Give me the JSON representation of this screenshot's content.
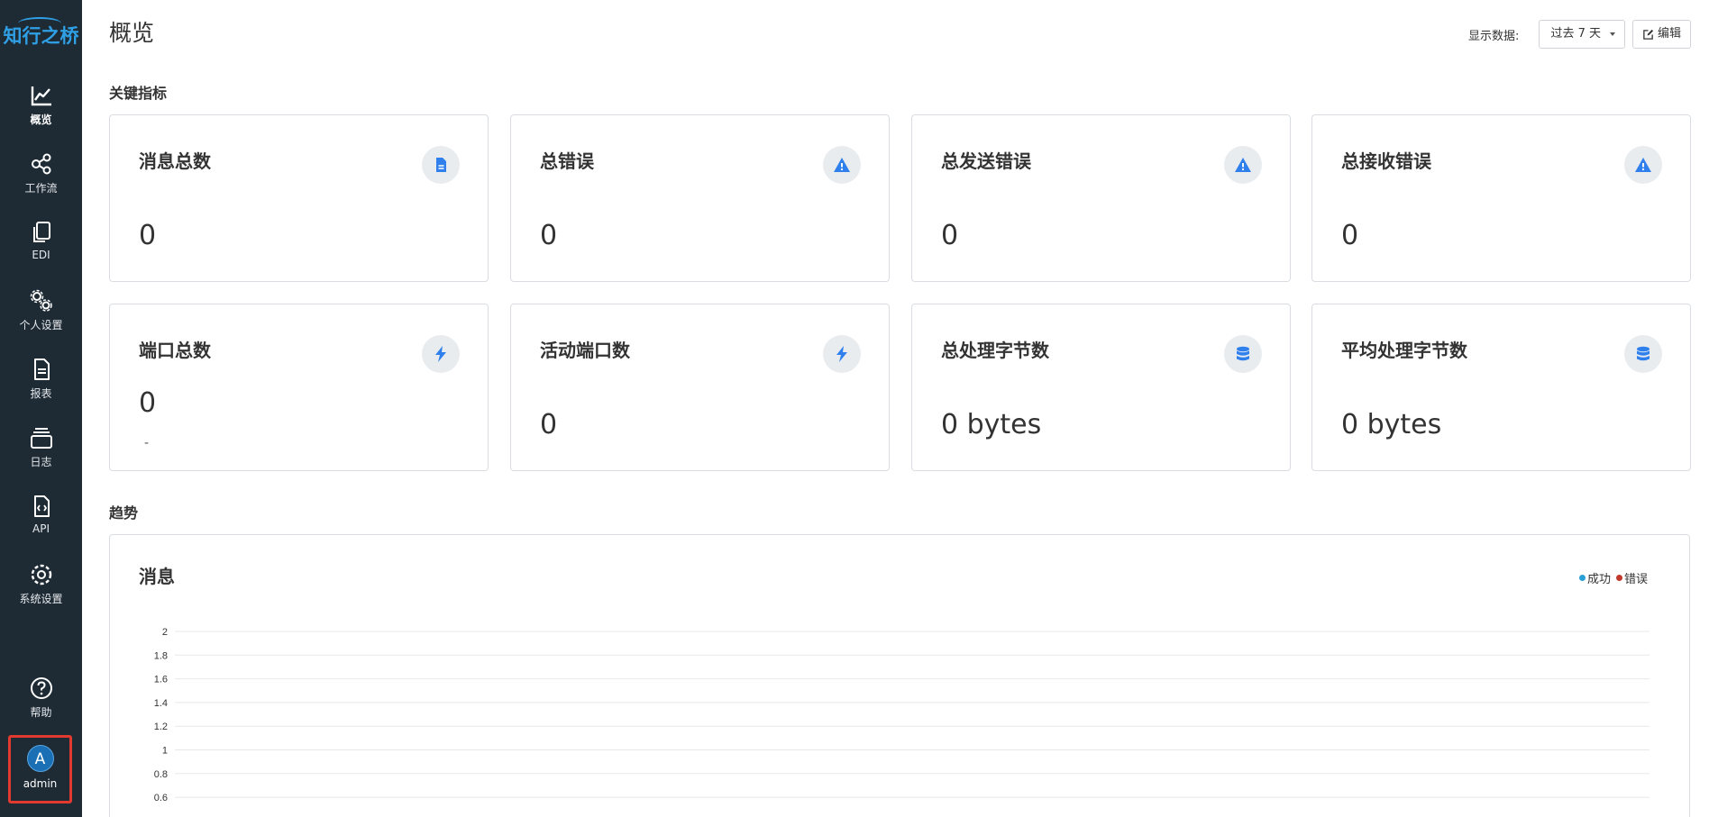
{
  "sidebar": {
    "logo": "知行之桥",
    "items": [
      {
        "label": "概览",
        "icon": "chart-line-icon"
      },
      {
        "label": "工作流",
        "icon": "share-nodes-icon"
      },
      {
        "label": "EDI",
        "icon": "copy-files-icon"
      },
      {
        "label": "个人设置",
        "icon": "gears-icon"
      },
      {
        "label": "报表",
        "icon": "document-icon"
      },
      {
        "label": "日志",
        "icon": "layers-icon"
      },
      {
        "label": "API",
        "icon": "file-code-icon"
      },
      {
        "label": "系统设置",
        "icon": "gear-icon"
      },
      {
        "label": "帮助",
        "icon": "question-circle-icon"
      }
    ],
    "user": {
      "initial": "A",
      "name": "admin"
    }
  },
  "header": {
    "title": "概览",
    "display_label": "显示数据:",
    "range_value": "过去 7 天",
    "edit_label": "编辑"
  },
  "sections": {
    "metrics": "关键指标",
    "trend": "趋势"
  },
  "metrics": [
    {
      "title": "消息总数",
      "value": "0",
      "sub": "",
      "icon": "file-icon"
    },
    {
      "title": "总错误",
      "value": "0",
      "sub": "",
      "icon": "warning-icon"
    },
    {
      "title": "总发送错误",
      "value": "0",
      "sub": "",
      "icon": "warning-icon"
    },
    {
      "title": "总接收错误",
      "value": "0",
      "sub": "",
      "icon": "warning-icon"
    },
    {
      "title": "端口总数",
      "value": "0",
      "sub": "-",
      "icon": "bolt-icon"
    },
    {
      "title": "活动端口数",
      "value": "0",
      "sub": "",
      "icon": "bolt-icon"
    },
    {
      "title": "总处理字节数",
      "value": "0 bytes",
      "sub": "",
      "icon": "database-icon"
    },
    {
      "title": "平均处理字节数",
      "value": "0 bytes",
      "sub": "",
      "icon": "database-icon"
    }
  ],
  "trend": {
    "title": "消息",
    "legend": [
      {
        "name": "成功",
        "color": "#2a9fd6"
      },
      {
        "name": "错误",
        "color": "#c0392b"
      }
    ]
  },
  "chart_data": {
    "type": "line",
    "title": "消息",
    "ylim": [
      0.6,
      2
    ],
    "yticks": [
      "2",
      "1.8",
      "1.6",
      "1.4",
      "1.2",
      "1",
      "0.8",
      "0.6"
    ],
    "series": [
      {
        "name": "成功",
        "values": []
      },
      {
        "name": "错误",
        "values": []
      }
    ],
    "legend": "top-right",
    "grid": true
  },
  "colors": {
    "sidebar_bg": "#1e2b35",
    "accent": "#2f80ed",
    "highlight_border": "#e23a2e"
  }
}
